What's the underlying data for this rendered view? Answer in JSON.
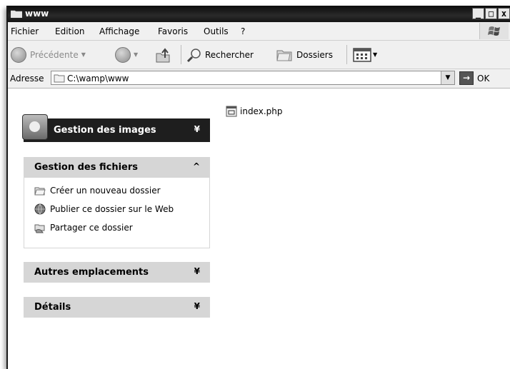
{
  "window": {
    "title": "www"
  },
  "titlebar": {
    "minimize": "_",
    "maximize": "□",
    "close": "x"
  },
  "menu": {
    "items": [
      "Fichier",
      "Edition",
      "Affichage",
      "Favoris",
      "Outils",
      "?"
    ]
  },
  "toolbar": {
    "back_label": "Précédente",
    "search_label": "Rechercher",
    "folders_label": "Dossiers"
  },
  "address": {
    "label": "Adresse",
    "value": "C:\\wamp\\www",
    "go_label": "OK"
  },
  "panels": {
    "images": {
      "title": "Gestion des images"
    },
    "files": {
      "title": "Gestion des fichiers",
      "tasks": [
        "Créer un nouveau dossier",
        "Publier ce dossier sur le Web",
        "Partager ce dossier"
      ]
    },
    "other": {
      "title": "Autres emplacements"
    },
    "details": {
      "title": "Détails"
    }
  },
  "files": [
    {
      "name": "index.php",
      "icon": "php-file-icon"
    }
  ],
  "colors": {
    "titlebar": "#111111",
    "panel_header": "#d6d6d6",
    "dark_panel": "#1e1e1e"
  }
}
